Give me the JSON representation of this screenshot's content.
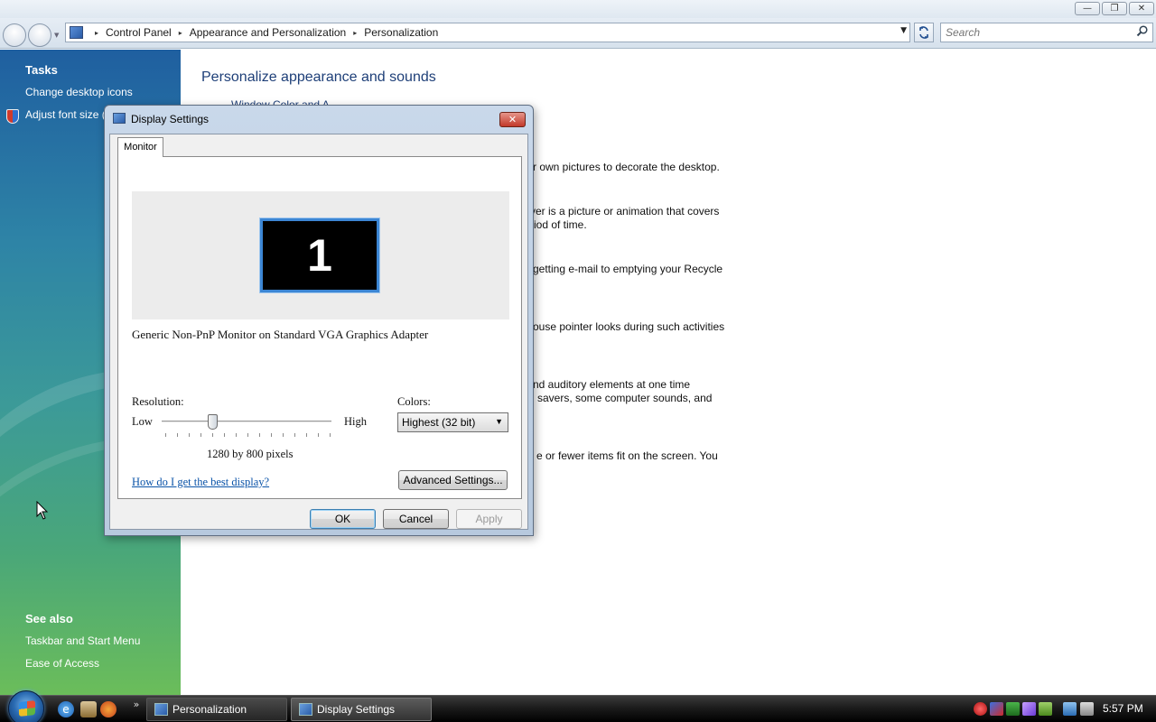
{
  "window": {
    "min_glyph": "—",
    "max_glyph": "❐",
    "close_glyph": "✕"
  },
  "address": {
    "crumbs": [
      "Control Panel",
      "Appearance and Personalization",
      "Personalization"
    ],
    "separator": "▸",
    "dropdown_glyph": "▼"
  },
  "search": {
    "placeholder": "Search",
    "icon": "search-icon"
  },
  "sidebar": {
    "tasks_heading": "Tasks",
    "tasks": [
      {
        "label": "Change desktop icons"
      },
      {
        "label": "Adjust font size ("
      }
    ],
    "see_also_heading": "See also",
    "see_also": [
      {
        "label": "Taskbar and Start Menu"
      },
      {
        "label": "Ease of Access"
      }
    ]
  },
  "main": {
    "title": "Personalize appearance and sounds",
    "partial_item": "Window Color and A",
    "lines": [
      "r own pictures to decorate the desktop.",
      "ver is a picture or animation that covers",
      "riod of time.",
      "getting e-mail to emptying your Recycle",
      "ouse pointer looks during such activities",
      "nd auditory elements at one time",
      "savers, some computer sounds, and",
      "e or fewer items fit on the screen. You"
    ]
  },
  "dialog": {
    "title": "Display Settings",
    "close_glyph": "✕",
    "tab": "Monitor",
    "monitor_number": "1",
    "monitor_name": "Generic Non-PnP Monitor on Standard VGA Graphics Adapter",
    "resolution_label": "Resolution:",
    "low_label": "Low",
    "high_label": "High",
    "resolution_value": "1280 by 800 pixels",
    "resolution_slider_fraction": 0.3,
    "colors_label": "Colors:",
    "colors_value": "Highest (32 bit)",
    "help_link": "How do I get the best display?",
    "advanced_button": "Advanced Settings...",
    "ok_button": "OK",
    "cancel_button": "Cancel",
    "apply_button": "Apply"
  },
  "taskbar": {
    "more_glyph": "»",
    "tasks": [
      {
        "label": "Personalization"
      },
      {
        "label": "Display Settings"
      }
    ],
    "clock": "5:57 PM"
  }
}
